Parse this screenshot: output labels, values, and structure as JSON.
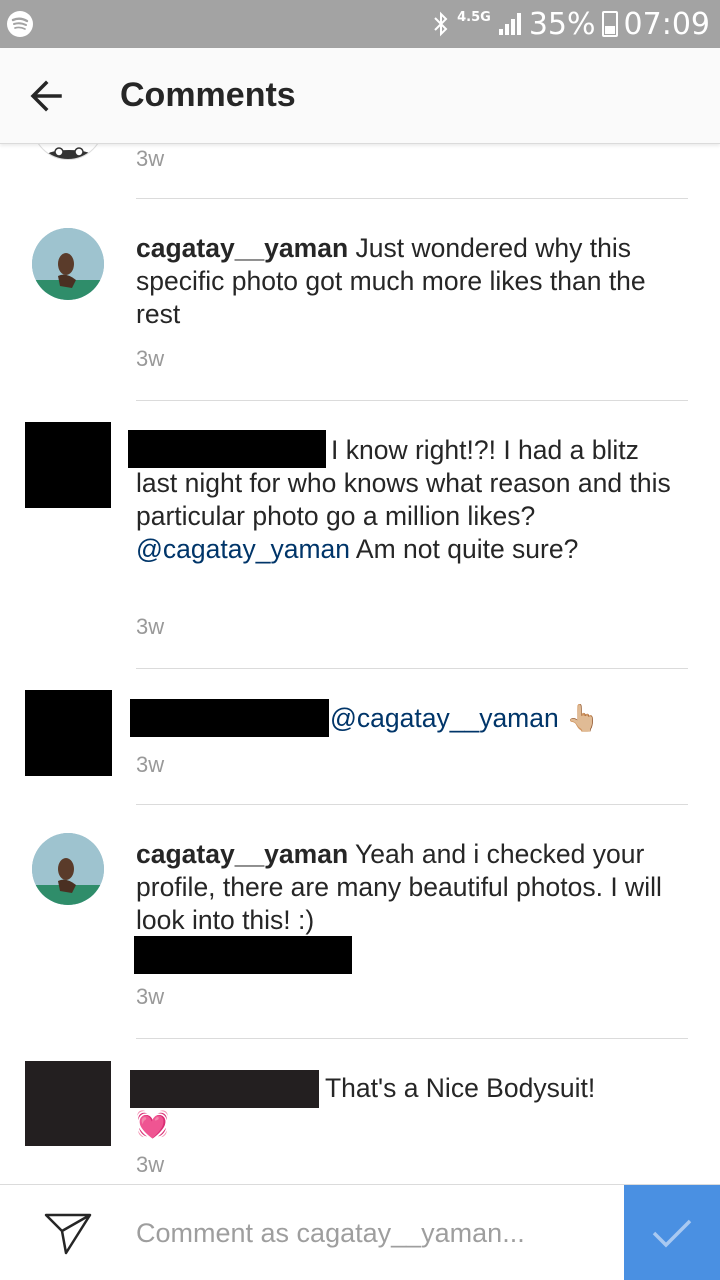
{
  "status_bar": {
    "network": "4.5G",
    "battery": "35%",
    "time": "07:09",
    "left_icon": "spotify-icon"
  },
  "header": {
    "title": "Comments",
    "back_icon": "back-arrow-icon"
  },
  "comments": [
    {
      "time": "3w"
    },
    {
      "username": "cagatay__yaman",
      "text": " Just wondered why this specific photo got much more likes than the rest",
      "time": "3w"
    },
    {
      "text_a": "I know right!?! I had a blitz last night for who knows what reason and this particular photo go a million likes? ",
      "mention": "@cagatay_yaman",
      "text_b": " Am not quite sure?",
      "time": "3w"
    },
    {
      "mention": "@cagatay__yaman",
      "emoji": "👆🏼",
      "time": "3w"
    },
    {
      "username": "cagatay__yaman",
      "text": " Yeah and i checked your profile, there are many beautiful photos. I will look into this! :)",
      "time": "3w"
    },
    {
      "text": "That's a Nice Bodysuit!",
      "emoji": "💓",
      "time": "3w"
    }
  ],
  "composer": {
    "placeholder": "Comment as cagatay__yaman...",
    "send_icon": "direct-send-icon",
    "post_icon": "checkmark-icon"
  },
  "colors": {
    "status_bar": "#a3a3a3",
    "mention": "#003569",
    "post_button": "#4a90e2",
    "timestamp": "#999999"
  }
}
